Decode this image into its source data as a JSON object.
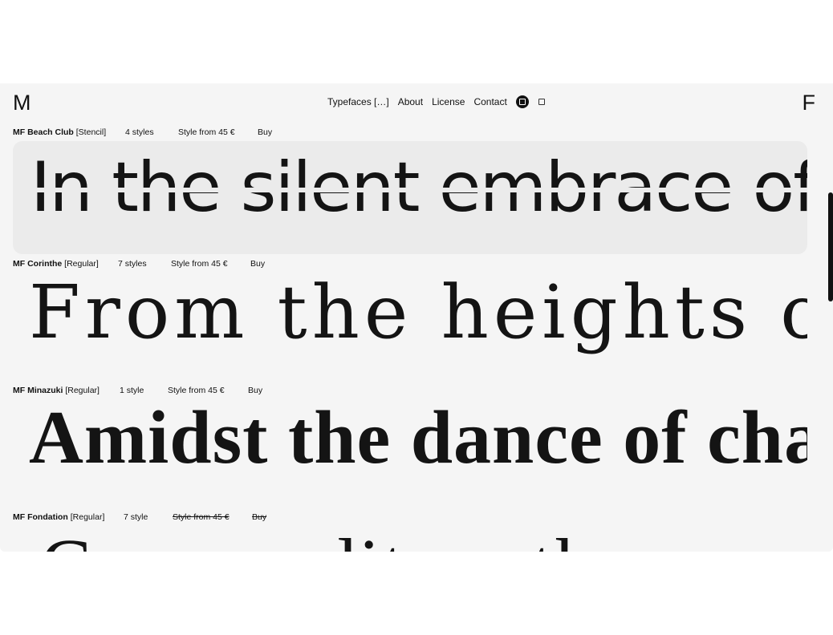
{
  "brand": {
    "left_mark": "M",
    "right_mark": "F"
  },
  "nav": {
    "items": [
      "Typefaces […]",
      "About",
      "License",
      "Contact"
    ],
    "dark_mode_icon": "square-in-circle-icon",
    "light_mode_icon": "square-icon"
  },
  "typefaces": [
    {
      "name": "MF Beach Club",
      "style_tag": "[Stencil]",
      "styles": "4 styles",
      "price": "Style from 45 €",
      "buy": "Buy",
      "specimen": "In the silent embrace of th",
      "available": true
    },
    {
      "name": "MF Corinthe",
      "style_tag": "[Regular]",
      "styles": "7 styles",
      "price": "Style from 45 €",
      "buy": "Buy",
      "specimen": "From the heights o",
      "available": true
    },
    {
      "name": "MF Minazuki",
      "style_tag": "[Regular]",
      "styles": "1 style",
      "price": "Style from 45 €",
      "buy": "Buy",
      "specimen": "Amidst the dance of cha",
      "available": true
    },
    {
      "name": "MF Fondation",
      "style_tag": "[Regular]",
      "styles": "7 style",
      "price": "Style from 45 €",
      "buy": "Buy",
      "specimen": "Comme dit un th",
      "available": false
    }
  ]
}
